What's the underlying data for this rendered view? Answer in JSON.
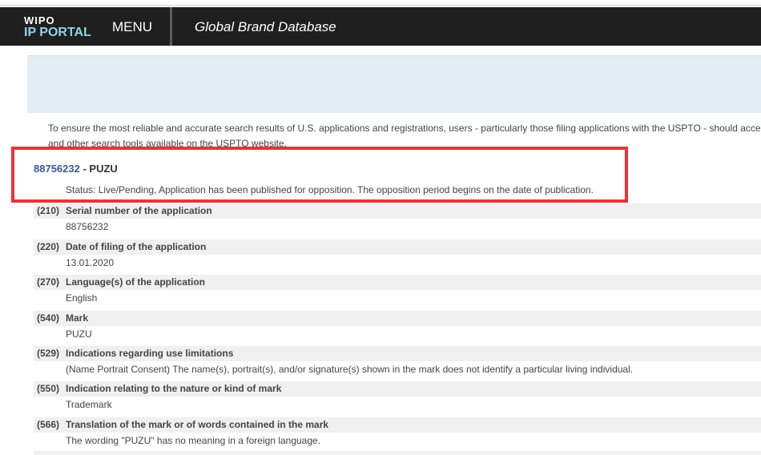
{
  "header": {
    "logo_top": "WIPO",
    "logo_bottom": "IP PORTAL",
    "menu_label": "MENU",
    "database_title": "Global Brand Database"
  },
  "notice": {
    "line1": "To ensure the most reliable and accurate search results of U.S. applications and registrations, users - particularly those filing applications with the USPTO - should acce",
    "line2": "and other search tools available on the USPTO website."
  },
  "result": {
    "serial": "88756232",
    "separator": " - ",
    "name": "PUZU",
    "status": "Status: Live/Pending, Application has been published for opposition. The opposition period begins on the date of publication."
  },
  "fields": [
    {
      "code": "(210)",
      "label": "Serial number of the application",
      "value": "88756232"
    },
    {
      "code": "(220)",
      "label": "Date of filing of the application",
      "value": "13.01.2020"
    },
    {
      "code": "(270)",
      "label": "Language(s) of the application",
      "value": "English"
    },
    {
      "code": "(540)",
      "label": "Mark",
      "value": "PUZU"
    },
    {
      "code": "(529)",
      "label": "Indications regarding use limitations",
      "value": "(Name Portrait Consent) The name(s), portrait(s), and/or signature(s) shown in the mark does not identify a particular living individual."
    },
    {
      "code": "(550)",
      "label": "Indication relating to the nature or kind of mark",
      "value": "Trademark"
    },
    {
      "code": "(566)",
      "label": "Translation of the mark or of words contained in the mark",
      "value": "The wording \"PUZU\" has no meaning in a foreign language."
    }
  ],
  "colors": {
    "header_bg": "#1f1f1f",
    "logo_accent": "#8fd3e8",
    "highlight_border": "#e8333a",
    "link": "#3a5a8c",
    "field_header_bg": "#f0f0f0",
    "banner_bg": "#e4ecf4"
  }
}
